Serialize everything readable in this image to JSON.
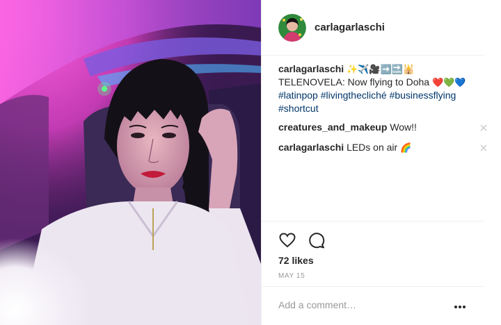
{
  "post": {
    "username": "carlagarlaschi",
    "caption": {
      "username": "carlagarlaschi",
      "emojis_1": "✨✈️🎥➡️🔜🕌",
      "text": "TELENOVELA: Now flying to Doha",
      "emojis_2": "❤️💚💙",
      "hashtags": [
        "#latinpop",
        "#livingthecliché",
        "#businessflying",
        "#shortcut"
      ]
    },
    "comments": [
      {
        "username": "creatures_and_makeup",
        "text": "Wow!!"
      },
      {
        "username": "carlagarlaschi",
        "text": "LEDs on air",
        "emoji": "🌈"
      }
    ],
    "likes": "72 likes",
    "date": "MAY 15",
    "comment_placeholder": "Add a comment…"
  },
  "icons": {
    "like": "heart-icon",
    "comment": "speech-bubble-icon",
    "delete": "close-icon",
    "more": "ellipsis-icon"
  },
  "colors": {
    "hashtag": "#003569",
    "border": "#efefef",
    "muted": "#999999",
    "text": "#262626"
  }
}
